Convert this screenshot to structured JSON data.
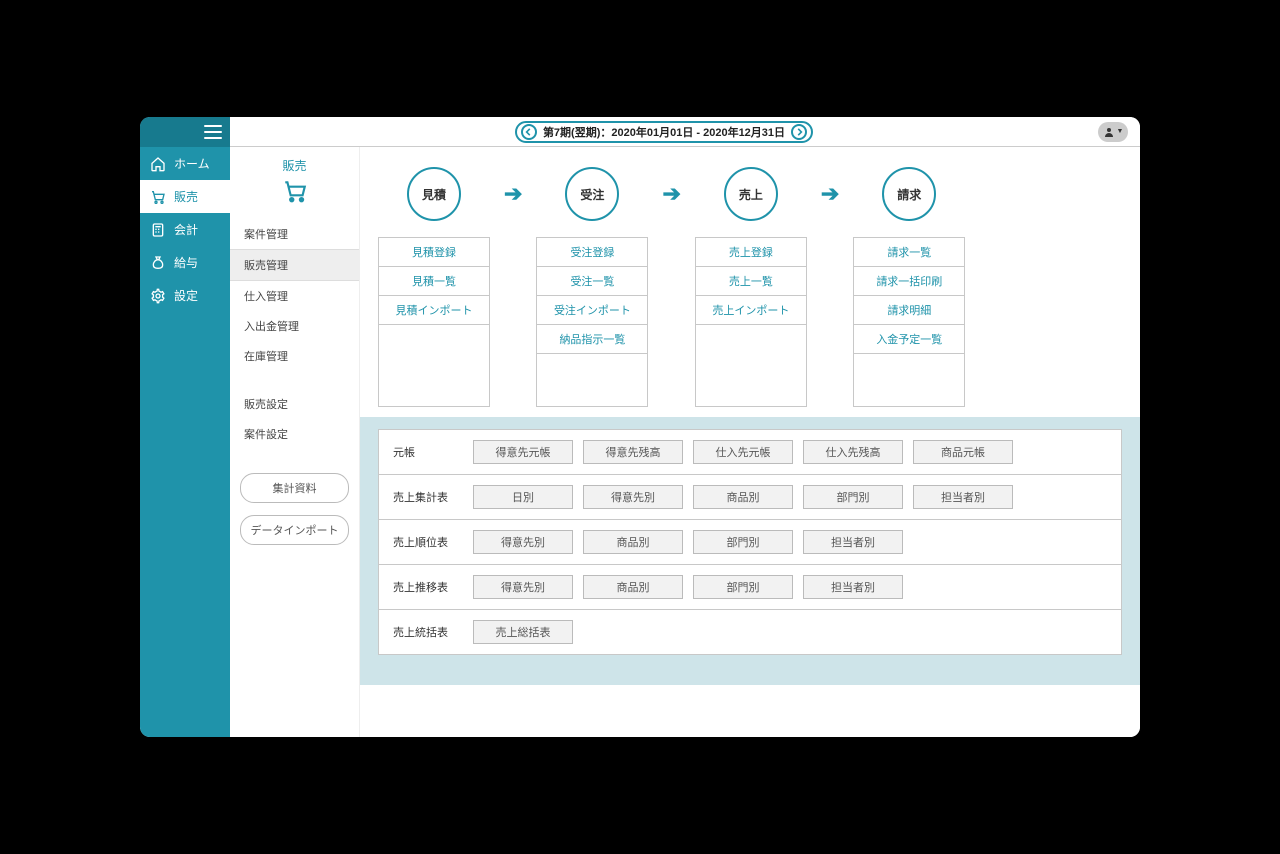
{
  "sidebar": {
    "items": [
      {
        "label": "ホーム"
      },
      {
        "label": "販売"
      },
      {
        "label": "会計"
      },
      {
        "label": "給与"
      },
      {
        "label": "設定"
      }
    ]
  },
  "topbar": {
    "period": "第7期(翌期)：2020年01月01日 - 2020年12月31日"
  },
  "subnav": {
    "title": "販売",
    "items": [
      "案件管理",
      "販売管理",
      "仕入管理",
      "入出金管理",
      "在庫管理"
    ],
    "settings": [
      "販売設定",
      "案件設定"
    ],
    "buttons": [
      "集計資料",
      "データインポート"
    ]
  },
  "flow": {
    "steps": [
      "見積",
      "受注",
      "売上",
      "請求"
    ],
    "links": {
      "step0": [
        "見積登録",
        "見積一覧",
        "見積インポート"
      ],
      "step1": [
        "受注登録",
        "受注一覧",
        "受注インポート",
        "納品指示一覧"
      ],
      "step2": [
        "売上登録",
        "売上一覧",
        "売上インポート"
      ],
      "step3": [
        "請求一覧",
        "請求一括印刷",
        "請求明細",
        "入金予定一覧"
      ]
    }
  },
  "reports": [
    {
      "label": "元帳",
      "chips": [
        "得意先元帳",
        "得意先残高",
        "仕入先元帳",
        "仕入先残高",
        "商品元帳"
      ]
    },
    {
      "label": "売上集計表",
      "chips": [
        "日別",
        "得意先別",
        "商品別",
        "部門別",
        "担当者別"
      ]
    },
    {
      "label": "売上順位表",
      "chips": [
        "得意先別",
        "商品別",
        "部門別",
        "担当者別"
      ]
    },
    {
      "label": "売上推移表",
      "chips": [
        "得意先別",
        "商品別",
        "部門別",
        "担当者別"
      ]
    },
    {
      "label": "売上統括表",
      "chips": [
        "売上総括表"
      ]
    }
  ]
}
